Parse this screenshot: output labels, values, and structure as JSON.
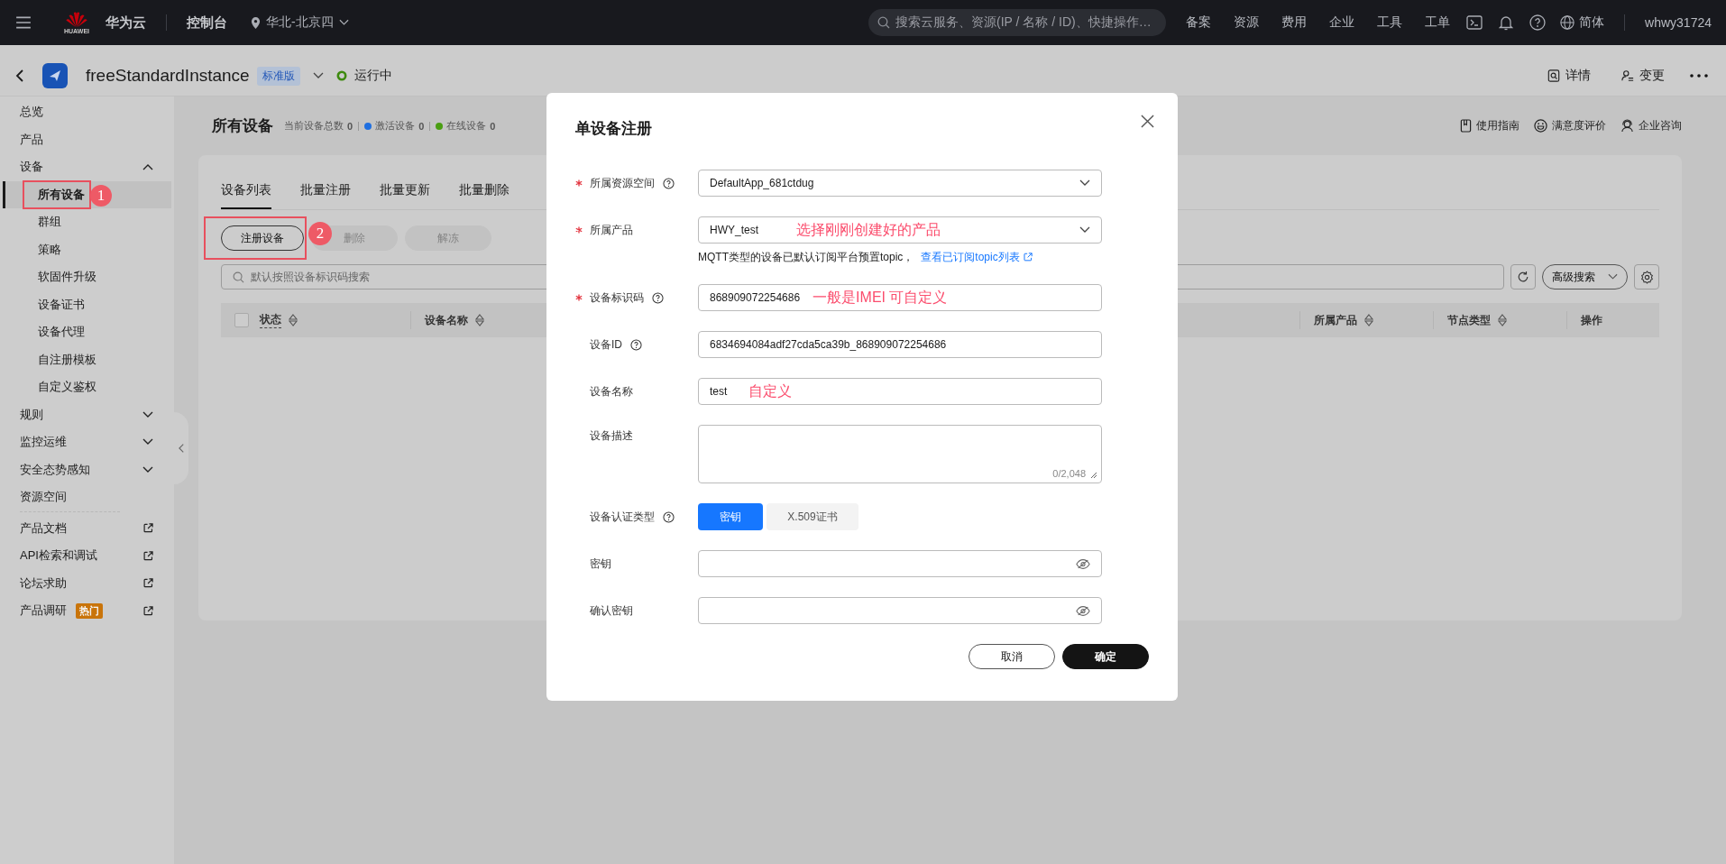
{
  "top_bar": {
    "logo_text": "HUAWEI",
    "brand": "华为云",
    "console": "控制台",
    "region": "华北-北京四",
    "search": {
      "placeholder": "搜索云服务、资源(IP / 名称 / ID)、快捷操作…"
    },
    "nav": [
      "备案",
      "资源",
      "费用",
      "企业",
      "工具",
      "工单"
    ],
    "language": "简体",
    "user": "whwy31724"
  },
  "instance_bar": {
    "name": "freeStandardInstance",
    "edition": "标准版",
    "status": "运行中",
    "actions": [
      "详情",
      "变更"
    ]
  },
  "sidebar": {
    "items": [
      {
        "label": "总览",
        "kind": "link"
      },
      {
        "label": "产品",
        "kind": "link"
      },
      {
        "label": "设备",
        "kind": "group",
        "expanded": true,
        "children": [
          {
            "label": "所有设备",
            "selected": true,
            "callout": "1"
          },
          {
            "label": "群组",
            "selected": false
          },
          {
            "label": "策略",
            "selected": false
          },
          {
            "label": "软固件升级",
            "selected": false
          },
          {
            "label": "设备证书",
            "selected": false
          },
          {
            "label": "设备代理",
            "selected": false
          },
          {
            "label": "自注册模板",
            "selected": false
          },
          {
            "label": "自定义鉴权",
            "selected": false
          }
        ]
      },
      {
        "label": "规则",
        "kind": "group",
        "expanded": false
      },
      {
        "label": "监控运维",
        "kind": "group",
        "expanded": false
      },
      {
        "label": "安全态势感知",
        "kind": "group",
        "expanded": false
      },
      {
        "label": "资源空间",
        "kind": "link"
      },
      {
        "label": "产品文档",
        "kind": "external"
      },
      {
        "label": "API检索和调试",
        "kind": "external"
      },
      {
        "label": "论坛求助",
        "kind": "external"
      },
      {
        "label": "产品调研",
        "kind": "external",
        "badge": "热门"
      }
    ]
  },
  "page": {
    "title": "所有设备",
    "stats": [
      {
        "label": "当前设备总数",
        "value": "0"
      },
      {
        "label": "激活设备",
        "value": "0",
        "color": "#1f6fe0"
      },
      {
        "label": "在线设备",
        "value": "0",
        "color": "#4a9e12"
      }
    ],
    "links": [
      "使用指南",
      "满意度评价",
      "企业咨询"
    ],
    "tabs": [
      {
        "label": "设备列表",
        "selected": true
      },
      {
        "label": "批量注册",
        "selected": false
      },
      {
        "label": "批量更新",
        "selected": false
      },
      {
        "label": "批量删除",
        "selected": false
      }
    ],
    "buttons": [
      {
        "label": "注册设备",
        "disabled": false,
        "callout": "2"
      },
      {
        "label": "删除",
        "disabled": true
      },
      {
        "label": "解冻",
        "disabled": true
      }
    ],
    "search": {
      "placeholder": "默认按照设备标识码搜索"
    },
    "advanced_search": "高级搜索",
    "table": {
      "select_all": {
        "checked": false
      },
      "columns": [
        {
          "label": "状态",
          "sortable": true
        },
        {
          "label": "设备名称",
          "sortable": true
        },
        {
          "label": "所属产品",
          "sortable": true
        },
        {
          "label": "节点类型",
          "sortable": true
        },
        {
          "label": "操作",
          "sortable": false
        }
      ]
    }
  },
  "dialog": {
    "title": "单设备注册",
    "fields": [
      {
        "kind": "select",
        "label": "所属资源空间",
        "required": true,
        "help": true,
        "value": "DefaultApp_681ctdug"
      },
      {
        "kind": "select",
        "label": "所属产品",
        "required": true,
        "help": false,
        "value": "HWY_test",
        "note": "选择刚刚创建好的产品",
        "hint": "MQTT类型的设备已默认订阅平台预置topic，",
        "hint_link": "查看已订阅topic列表"
      },
      {
        "kind": "input",
        "label": "设备标识码",
        "required": true,
        "help": true,
        "value": "868909072254686",
        "note": "一般是IMEI 可自定义"
      },
      {
        "kind": "input",
        "label": "设备ID",
        "required": false,
        "help": true,
        "value": "6834694084adf27cda5ca39b_868909072254686"
      },
      {
        "kind": "input",
        "label": "设备名称",
        "required": false,
        "help": false,
        "value": "test",
        "note": "自定义"
      },
      {
        "kind": "textarea",
        "label": "设备描述",
        "required": false,
        "help": false,
        "counter": "0/2,048"
      },
      {
        "kind": "segmented",
        "label": "设备认证类型",
        "required": false,
        "help": true,
        "options": [
          {
            "label": "密钥",
            "selected": true
          },
          {
            "label": "X.509证书",
            "selected": false
          }
        ]
      },
      {
        "kind": "password",
        "label": "密钥",
        "required": false,
        "help": false
      },
      {
        "kind": "password",
        "label": "确认密钥",
        "required": false,
        "help": false
      }
    ],
    "buttons": [
      {
        "label": "取消",
        "primary": false
      },
      {
        "label": "确定",
        "primary": true
      }
    ]
  }
}
